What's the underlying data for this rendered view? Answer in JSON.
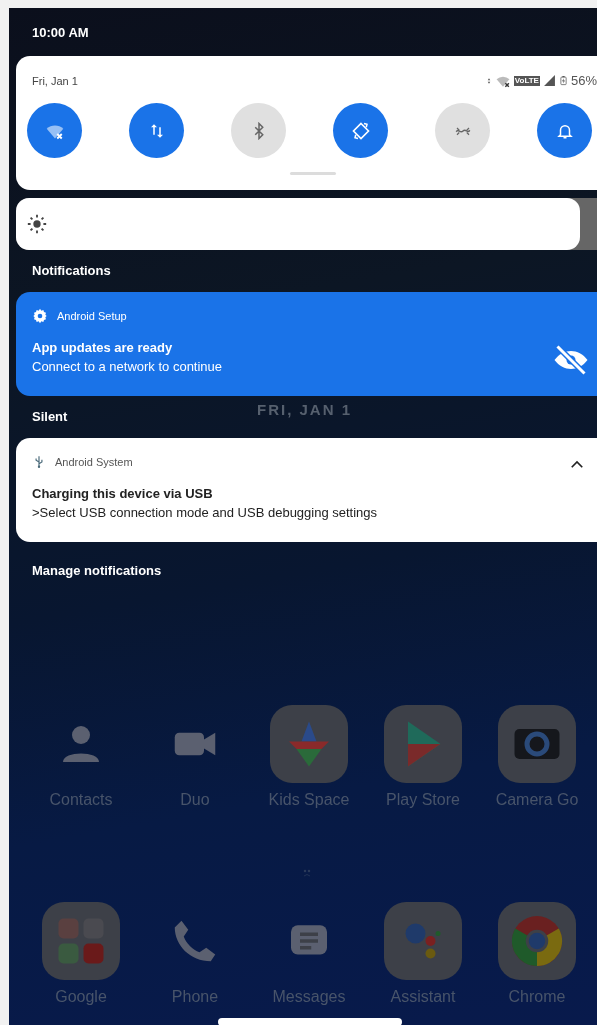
{
  "status_bar": {
    "time": "10:00 AM"
  },
  "quick_settings": {
    "date": "Fri, Jan 1",
    "volte_badge": "VoLTE",
    "battery": "56%",
    "tiles": [
      {
        "kind": "wifi",
        "on": true
      },
      {
        "kind": "data",
        "on": true
      },
      {
        "kind": "bluetooth",
        "on": false
      },
      {
        "kind": "rotate",
        "on": true
      },
      {
        "kind": "hotspot",
        "on": false
      },
      {
        "kind": "sound",
        "on": true
      }
    ]
  },
  "brightness": {
    "level": 0.94
  },
  "sections": [
    {
      "header": "Notifications",
      "notification": {
        "kind": "alert",
        "app": "Android Setup",
        "title": "App updates are ready",
        "text": "Connect to a network to continue"
      }
    },
    {
      "header": "Silent",
      "notification": {
        "kind": "silent",
        "app": "Android System",
        "title": "Charging this device via USB",
        "text": ">Select USB connection mode and USB debugging settings",
        "expanded": true
      }
    }
  ],
  "manage_link": "Manage notifications",
  "lockscreen_date": "FRI, JAN 1",
  "home": {
    "rows": [
      [
        {
          "kind": "contacts",
          "label": "Contacts"
        },
        {
          "kind": "duo",
          "label": "Duo"
        },
        {
          "kind": "kids",
          "label": "Kids Space"
        },
        {
          "kind": "play",
          "label": "Play Store"
        },
        {
          "kind": "camera",
          "label": "Camera Go"
        }
      ],
      [
        {
          "kind": "folder",
          "label": "Google"
        },
        {
          "kind": "phone",
          "label": "Phone"
        },
        {
          "kind": "messages",
          "label": "Messages"
        },
        {
          "kind": "assistant",
          "label": "Assistant"
        },
        {
          "kind": "chrome",
          "label": "Chrome"
        }
      ]
    ]
  }
}
